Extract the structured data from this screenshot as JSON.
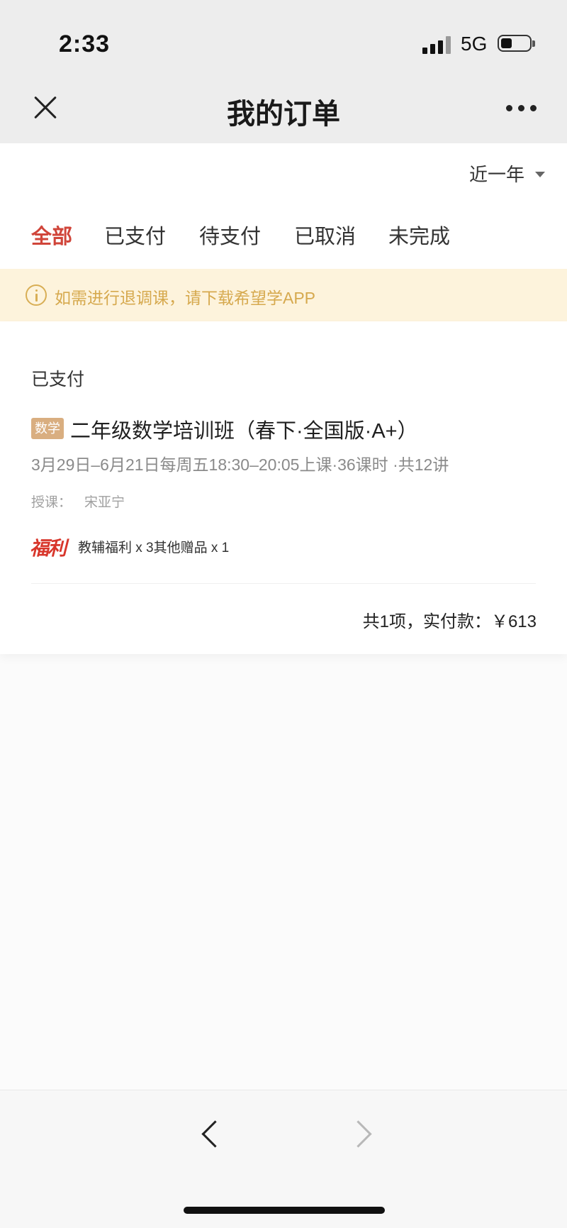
{
  "status_bar": {
    "time": "2:33",
    "network": "5G",
    "icons": [
      "signal-icon",
      "battery-icon"
    ]
  },
  "nav": {
    "title": "我的订单",
    "icons": [
      "close-icon",
      "more-icon"
    ]
  },
  "filter": {
    "period": "近一年",
    "icon": "caret-down-icon"
  },
  "tabs": [
    {
      "label": "全部",
      "active": true
    },
    {
      "label": "已支付",
      "active": false
    },
    {
      "label": "待支付",
      "active": false
    },
    {
      "label": "已取消",
      "active": false
    },
    {
      "label": "未完成",
      "active": false
    }
  ],
  "notice": {
    "icon": "info-icon",
    "text": "如需进行退调课，请下载希望学APP"
  },
  "orders": [
    {
      "status": "已支付",
      "subject_tag": "数学",
      "title": "二年级数学培训班（春下·全国版·A+）",
      "schedule": "3月29日–6月21日每周五18:30–20:05上课·36课时 ·共12讲",
      "teacher_label": "授课：",
      "teacher": "宋亚宁",
      "benefit_badge": "福利",
      "benefits": "教辅福利 x 3其他赠品 x 1",
      "total": "共1项，实付款：￥613"
    }
  ],
  "toolbar": {
    "icons": [
      "back-icon",
      "forward-icon"
    ]
  },
  "colors": {
    "accent": "#d0453a",
    "notice_bg": "#fdf3dc",
    "notice_text": "#d6a94e",
    "subject_tag_bg": "#d9ae80",
    "benefit_badge": "#d8362b"
  }
}
